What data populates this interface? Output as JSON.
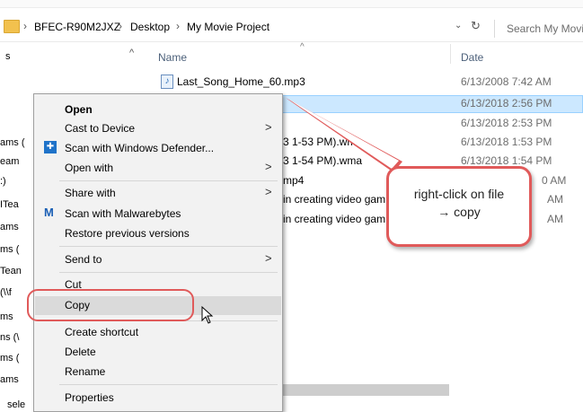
{
  "address": {
    "segments": [
      "BFEC-R90M2JXZ",
      "Desktop",
      "My Movie Project"
    ],
    "search_placeholder": "Search My Movi"
  },
  "columns": {
    "name": "Name",
    "date": "Date"
  },
  "files": [
    {
      "name": "Last_Song_Home_60.mp3",
      "date": "6/13/2008 7:42 AM"
    },
    {
      "name": "",
      "date": "6/13/2018 2:56 PM"
    },
    {
      "name": "",
      "date": "6/13/2018 2:53 PM"
    },
    {
      "name": "3 1-53 PM).wma",
      "date": "6/13/2018 1:53 PM"
    },
    {
      "name": "3 1-54 PM).wma",
      "date": "6/13/2018 1:54 PM"
    },
    {
      "name": "mp4",
      "date": "0 AM"
    },
    {
      "name": "in creating video gam",
      "date": "AM"
    },
    {
      "name": "in creating video gam",
      "date": "AM"
    }
  ],
  "navpane": {
    "items": [
      "s",
      "ams (",
      "eam",
      ":)",
      "ITea",
      "ams",
      "ms (",
      "Tean",
      " (\\\\f",
      "ms",
      "ns (\\",
      "ms (",
      "ams",
      "sele"
    ]
  },
  "menu": {
    "open": "Open",
    "cast": "Cast to Device",
    "scan_defender": "Scan with Windows Defender...",
    "open_with": "Open with",
    "share_with": "Share with",
    "scan_malwarebytes": "Scan with Malwarebytes",
    "restore": "Restore previous versions",
    "send_to": "Send to",
    "cut": "Cut",
    "copy": "Copy",
    "create_shortcut": "Create shortcut",
    "delete": "Delete",
    "rename": "Rename",
    "properties": "Properties"
  },
  "callout": {
    "line1": "right-click on file",
    "line2": "→ copy"
  },
  "colors": {
    "annotation": "#e05a5a",
    "selection": "#cce8ff",
    "menu_bg": "#f2f2f2"
  }
}
